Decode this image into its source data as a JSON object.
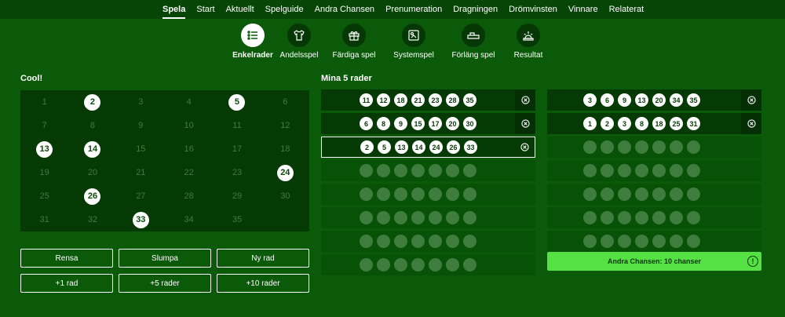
{
  "nav": [
    "Spela",
    "Start",
    "Aktuellt",
    "Spelguide",
    "Andra Chansen",
    "Prenumeration",
    "Dragningen",
    "Drömvinsten",
    "Vinnare",
    "Relaterat"
  ],
  "nav_active": 0,
  "game_tabs": [
    {
      "label": "Enkelrader",
      "icon": "list-icon"
    },
    {
      "label": "Andelsspel",
      "icon": "shirt-icon"
    },
    {
      "label": "Färdiga spel",
      "icon": "gift-icon"
    },
    {
      "label": "Systemspel",
      "icon": "coupon-icon"
    },
    {
      "label": "Förläng spel",
      "icon": "ticket-icon"
    },
    {
      "label": "Resultat",
      "icon": "sunrise-icon"
    }
  ],
  "game_tab_active": 0,
  "grid": {
    "title": "Cool!",
    "numbers": [
      1,
      2,
      3,
      4,
      5,
      6,
      7,
      8,
      9,
      10,
      11,
      12,
      13,
      14,
      15,
      16,
      17,
      18,
      19,
      20,
      21,
      22,
      23,
      24,
      25,
      26,
      27,
      28,
      29,
      30,
      31,
      32,
      33,
      34,
      35
    ],
    "selected": [
      2,
      5,
      13,
      14,
      24,
      26,
      33
    ]
  },
  "buttons": {
    "clear": "Rensa",
    "random": "Slumpa",
    "new_row": "Ny rad",
    "plus1": "+1 rad",
    "plus5": "+5 rader",
    "plus10": "+10 rader"
  },
  "rows_title": "Mina 5 rader",
  "rows_left": [
    {
      "numbers": [
        11,
        12,
        18,
        21,
        23,
        28,
        35
      ],
      "state": "filled"
    },
    {
      "numbers": [
        6,
        8,
        9,
        15,
        17,
        20,
        30
      ],
      "state": "filled"
    },
    {
      "numbers": [
        2,
        5,
        13,
        14,
        24,
        26,
        33
      ],
      "state": "active"
    },
    {
      "numbers": [],
      "state": "empty"
    },
    {
      "numbers": [],
      "state": "empty"
    },
    {
      "numbers": [],
      "state": "empty"
    },
    {
      "numbers": [],
      "state": "empty"
    },
    {
      "numbers": [],
      "state": "empty"
    }
  ],
  "rows_right": [
    {
      "numbers": [
        3,
        6,
        9,
        13,
        20,
        34,
        35
      ],
      "state": "filled"
    },
    {
      "numbers": [
        1,
        2,
        3,
        8,
        18,
        25,
        31
      ],
      "state": "filled"
    },
    {
      "numbers": [],
      "state": "empty"
    },
    {
      "numbers": [],
      "state": "empty"
    },
    {
      "numbers": [],
      "state": "empty"
    },
    {
      "numbers": [],
      "state": "empty"
    },
    {
      "numbers": [],
      "state": "empty"
    }
  ],
  "chance_bar": "Andra Chansen: 10 chanser",
  "colors": {
    "bg": "#0a5a0a",
    "accent": "#55e043",
    "panel": "#053a05"
  }
}
